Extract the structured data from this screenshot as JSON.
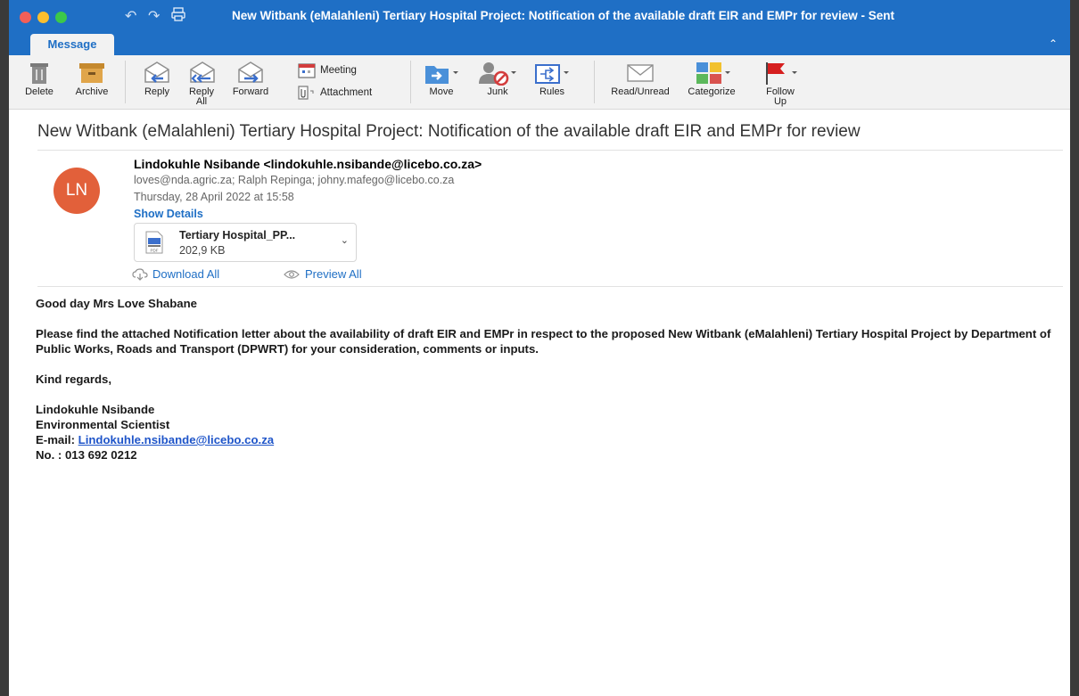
{
  "window": {
    "title": "New Witbank (eMalahleni) Tertiary Hospital Project: Notification of the available draft EIR and EMPr for review - Sent",
    "tab": "Message"
  },
  "ribbon": {
    "delete": "Delete",
    "archive": "Archive",
    "reply": "Reply",
    "reply_all": "Reply All",
    "forward": "Forward",
    "meeting": "Meeting",
    "attachment": "Attachment",
    "move": "Move",
    "junk": "Junk",
    "rules": "Rules",
    "read_unread": "Read/Unread",
    "categorize": "Categorize",
    "follow_up": "Follow Up"
  },
  "email": {
    "subject": "New Witbank (eMalahleni) Tertiary Hospital Project: Notification of the available draft EIR and EMPr for review",
    "avatar_initials": "LN",
    "sender": "Lindokuhle Nsibande <lindokuhle.nsibande@licebo.co.za>",
    "recipients": "loves@nda.agric.za;  Ralph Repinga;  johny.mafego@licebo.co.za",
    "datetime": "Thursday, 28 April 2022 at 15:58",
    "show_details": "Show Details",
    "attachment": {
      "name": "Tertiary Hospital_PP...",
      "size": "202,9 KB",
      "type_label": "PDF"
    },
    "download_all": "Download All",
    "preview_all": "Preview All",
    "body": {
      "greeting": "Good day Mrs Love Shabane",
      "paragraph": "Please find the attached Notification letter about the availability of draft EIR and EMPr in respect to the proposed New Witbank (eMalahleni) Tertiary Hospital Project by Department of Public Works, Roads and Transport (DPWRT) for your consideration, comments or inputs.",
      "closing": "Kind regards,",
      "sig_name": "Lindokuhle Nsibande",
      "sig_title": "Environmental Scientist",
      "sig_email_label": "E-mail: ",
      "sig_email": "Lindokuhle.nsibande@licebo.co.za",
      "sig_phone": "No. : 013 692 0212"
    }
  },
  "colors": {
    "titlebar": "#1f6fc5",
    "avatar": "#e2603a",
    "link": "#1f6fc5"
  }
}
